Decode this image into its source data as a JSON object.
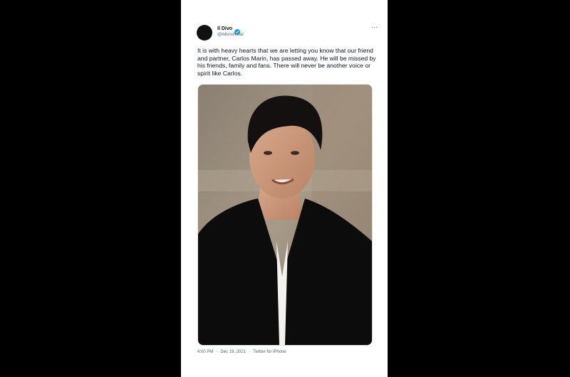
{
  "tweet": {
    "display_name": "Il Divo",
    "handle": "@ildivoofficial",
    "verified_icon": "verified-badge-icon",
    "more_icon": "more-options-icon",
    "text": "It is with heavy hearts that we are letting you know that our friend and partner, Carlos Marin, has passed away. He will be missed by his friends, family and fans.  There will never be another voice or spirit like Carlos.",
    "time": "4:00 PM",
    "date": "Dec 19, 2021",
    "source": "Twitter for iPhone",
    "separator": "·"
  },
  "colors": {
    "verified": "#1d9bf0",
    "text": "#0f1419",
    "secondary": "#536471"
  }
}
